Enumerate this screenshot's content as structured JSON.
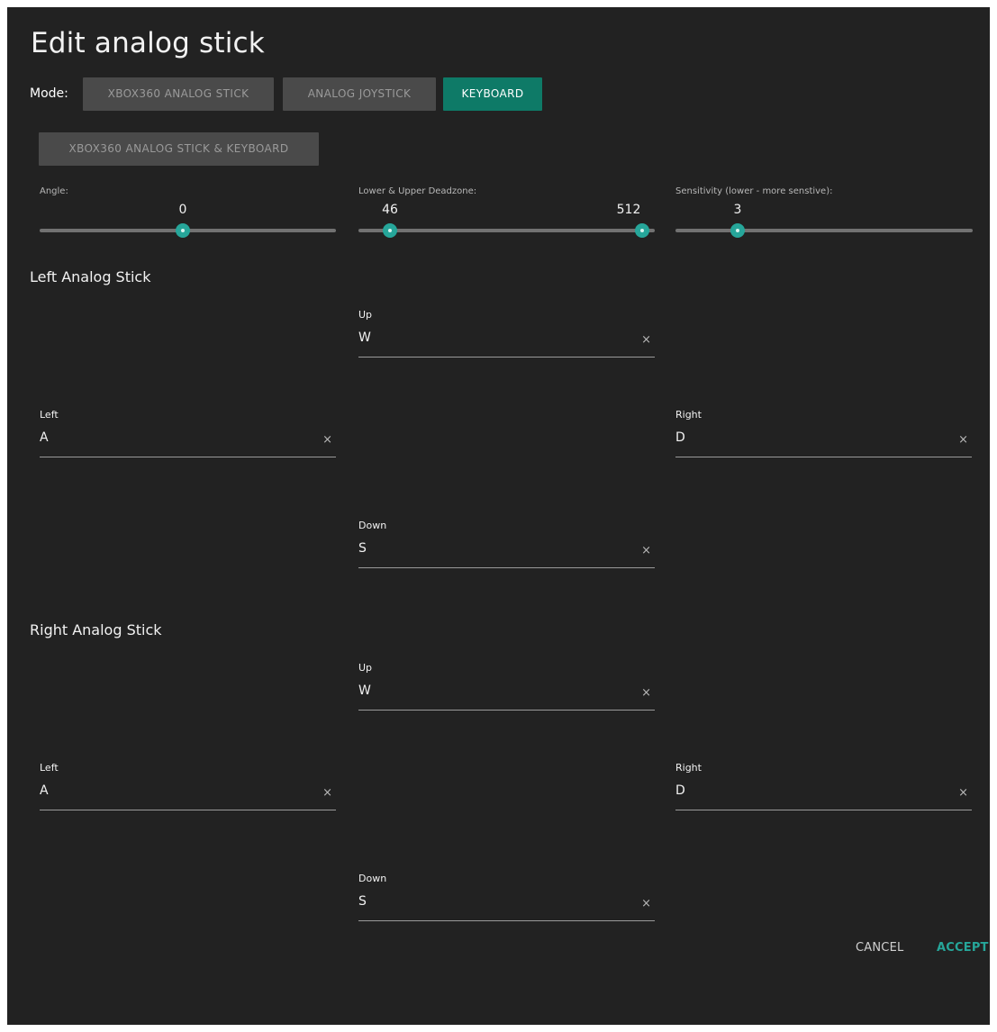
{
  "dialog": {
    "title": "Edit analog stick",
    "mode_label": "Mode:",
    "modes": [
      {
        "label": "XBOX360 ANALOG STICK",
        "active": false
      },
      {
        "label": "ANALOG JOYSTICK",
        "active": false
      },
      {
        "label": "KEYBOARD",
        "active": true
      },
      {
        "label": "XBOX360 ANALOG STICK & KEYBOARD",
        "active": false
      }
    ]
  },
  "sliders": {
    "angle": {
      "label": "Angle:",
      "value": "0"
    },
    "deadzone": {
      "label": "Lower & Upper Deadzone:",
      "lower": "46",
      "upper": "512"
    },
    "sensitivity": {
      "label": "Sensitivity (lower - more senstive):",
      "value": "3"
    }
  },
  "left_stick": {
    "title": "Left Analog Stick",
    "up": {
      "label": "Up",
      "value": "W"
    },
    "left": {
      "label": "Left",
      "value": "A"
    },
    "right": {
      "label": "Right",
      "value": "D"
    },
    "down": {
      "label": "Down",
      "value": "S"
    }
  },
  "right_stick": {
    "title": "Right Analog Stick",
    "up": {
      "label": "Up",
      "value": "W"
    },
    "left": {
      "label": "Left",
      "value": "A"
    },
    "right": {
      "label": "Right",
      "value": "D"
    },
    "down": {
      "label": "Down",
      "value": "S"
    }
  },
  "clear_glyph": "×",
  "footer": {
    "cancel": "CANCEL",
    "accept": "ACCEPT"
  },
  "colors": {
    "accent": "#26a69a",
    "active_button": "#0e7a67",
    "background": "#222222"
  }
}
